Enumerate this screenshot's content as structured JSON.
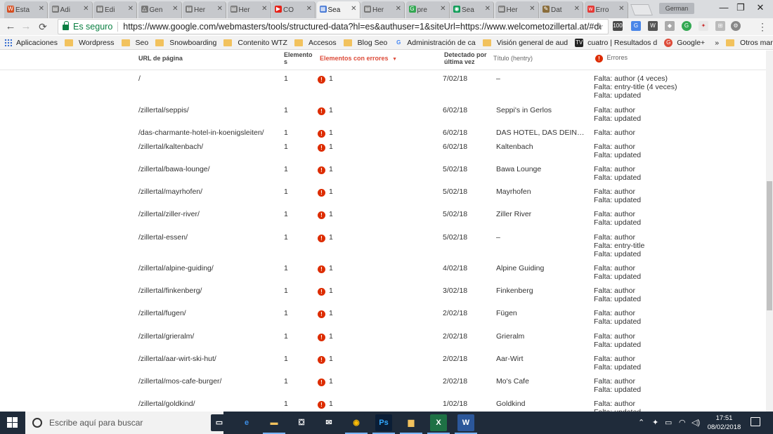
{
  "browser": {
    "tabs": [
      {
        "label": "Esta",
        "icon": "wordpress-icon",
        "color": "#d54e21",
        "active": false
      },
      {
        "label": "Adi",
        "icon": "document-icon",
        "color": "#777777",
        "active": false
      },
      {
        "label": "Edi",
        "icon": "document-icon",
        "color": "#777777",
        "active": false
      },
      {
        "label": "Gen",
        "icon": "drive-icon",
        "color": "#777777",
        "active": false
      },
      {
        "label": "Her",
        "icon": "document-icon",
        "color": "#777777",
        "active": false
      },
      {
        "label": "Her",
        "icon": "document-icon",
        "color": "#777777",
        "active": false
      },
      {
        "label": "CO",
        "icon": "youtube-icon",
        "color": "#e62117",
        "active": false
      },
      {
        "label": "Sea",
        "icon": "search-console-icon",
        "color": "#4a7bd6",
        "active": true
      },
      {
        "label": "Her",
        "icon": "document-icon",
        "color": "#777777",
        "active": false
      },
      {
        "label": "pre",
        "icon": "google-icon",
        "color": "#34a853",
        "active": false
      },
      {
        "label": "Sea",
        "icon": "chrome-icon",
        "color": "#0f9d58",
        "active": false
      },
      {
        "label": "Her",
        "icon": "document-icon",
        "color": "#777777",
        "active": false
      },
      {
        "label": "Dat",
        "icon": "pen-icon",
        "color": "#8a6d3b",
        "active": false
      },
      {
        "label": "Erro",
        "icon": "w-icon",
        "color": "#e53935",
        "active": false
      }
    ],
    "profile_name": "German",
    "address": {
      "secure_label": "Es seguro",
      "url": "https://www.google.com/webmasters/tools/structured-data?hl=es&authuser=1&siteUrl=https://www.welcometozillertal.at/#details/htt..."
    },
    "bookmarks": [
      {
        "label": "Aplicaciones",
        "type": "apps"
      },
      {
        "label": "Wordpress",
        "type": "folder"
      },
      {
        "label": "Seo",
        "type": "folder"
      },
      {
        "label": "Snowboarding",
        "type": "folder"
      },
      {
        "label": "Contenito WTZ",
        "type": "folder"
      },
      {
        "label": "Accesos",
        "type": "folder"
      },
      {
        "label": "Blog Seo",
        "type": "folder"
      },
      {
        "label": "Administración de ca",
        "type": "google"
      },
      {
        "label": "Visión general de aud",
        "type": "folder"
      },
      {
        "label": "cuatro | Resultados d",
        "type": "tv"
      },
      {
        "label": "Google+",
        "type": "gplus"
      }
    ],
    "bookmarks_more": "»",
    "other_bookmarks": "Otros marcadores"
  },
  "table": {
    "headers": {
      "url": "URL de página",
      "elements_line1": "Elemento",
      "elements_line2": "s",
      "errors_items": "Elementos con errores",
      "detected_line1": "Detectado por",
      "detected_line2": "última vez",
      "title": "Título (hentry)",
      "errors": "Errores"
    },
    "rows": [
      {
        "url": "/",
        "elements": "1",
        "error_count": "1",
        "date": "7/02/18",
        "title": "–",
        "errors": [
          "Falta: author (4 veces)",
          "Falta: entry-title (4 veces)",
          "Falta: updated"
        ]
      },
      {
        "url": "/zillertal/seppis/",
        "elements": "1",
        "error_count": "1",
        "date": "6/02/18",
        "title": "Seppi's in Gerlos",
        "errors": [
          "Falta: author",
          "Falta: updated"
        ]
      },
      {
        "url": "/das-charmante-hotel-in-koenigsleiten/",
        "elements": "1",
        "error_count": "1",
        "date": "6/02/18",
        "title": "DAS HOTEL, DAS DEINE ...",
        "errors": [
          "Falta: author"
        ]
      },
      {
        "url": "/zillertal/kaltenbach/",
        "elements": "1",
        "error_count": "1",
        "date": "6/02/18",
        "title": "Kaltenbach",
        "errors": [
          "Falta: author",
          "Falta: updated"
        ]
      },
      {
        "url": "/zillertal/bawa-lounge/",
        "elements": "1",
        "error_count": "1",
        "date": "5/02/18",
        "title": "Bawa Lounge",
        "errors": [
          "Falta: author",
          "Falta: updated"
        ]
      },
      {
        "url": "/zillertal/mayrhofen/",
        "elements": "1",
        "error_count": "1",
        "date": "5/02/18",
        "title": "Mayrhofen",
        "errors": [
          "Falta: author",
          "Falta: updated"
        ]
      },
      {
        "url": "/zillertal/ziller-river/",
        "elements": "1",
        "error_count": "1",
        "date": "5/02/18",
        "title": "Ziller River",
        "errors": [
          "Falta: author",
          "Falta: updated"
        ]
      },
      {
        "url": "/zillertal-essen/",
        "elements": "1",
        "error_count": "1",
        "date": "5/02/18",
        "title": "–",
        "errors": [
          "Falta: author",
          "Falta: entry-title",
          "Falta: updated"
        ]
      },
      {
        "url": "/zillertal/alpine-guiding/",
        "elements": "1",
        "error_count": "1",
        "date": "4/02/18",
        "title": "Alpine Guiding",
        "errors": [
          "Falta: author",
          "Falta: updated"
        ]
      },
      {
        "url": "/zillertal/finkenberg/",
        "elements": "1",
        "error_count": "1",
        "date": "3/02/18",
        "title": "Finkenberg",
        "errors": [
          "Falta: author",
          "Falta: updated"
        ]
      },
      {
        "url": "/zillertal/fugen/",
        "elements": "1",
        "error_count": "1",
        "date": "2/02/18",
        "title": "Fügen",
        "errors": [
          "Falta: author",
          "Falta: updated"
        ]
      },
      {
        "url": "/zillertal/grieralm/",
        "elements": "1",
        "error_count": "1",
        "date": "2/02/18",
        "title": "Grieralm",
        "errors": [
          "Falta: author",
          "Falta: updated"
        ]
      },
      {
        "url": "/zillertal/aar-wirt-ski-hut/",
        "elements": "1",
        "error_count": "1",
        "date": "2/02/18",
        "title": "Aar-Wirt",
        "errors": [
          "Falta: author",
          "Falta: updated"
        ]
      },
      {
        "url": "/zillertal/mos-cafe-burger/",
        "elements": "1",
        "error_count": "1",
        "date": "2/02/18",
        "title": "Mo's Cafe",
        "errors": [
          "Falta: author",
          "Falta: updated"
        ]
      },
      {
        "url": "/zillertal/goldkind/",
        "elements": "1",
        "error_count": "1",
        "date": "1/02/18",
        "title": "Goldkind",
        "errors": [
          "Falta: author",
          "Falta: updated"
        ]
      }
    ]
  },
  "taskbar": {
    "search_placeholder": "Escribe aquí para buscar",
    "time": "17:51",
    "date": "08/02/2018",
    "apps": [
      {
        "label": "",
        "icon": "task-view-icon"
      },
      {
        "label": "e",
        "icon": "edge-icon"
      },
      {
        "label": "",
        "icon": "file-explorer-icon"
      },
      {
        "label": "",
        "icon": "store-icon"
      },
      {
        "label": "",
        "icon": "mail-icon"
      },
      {
        "label": "",
        "icon": "chrome-icon"
      },
      {
        "label": "Ps",
        "icon": "photoshop-icon"
      },
      {
        "label": "",
        "icon": "folder-app-icon"
      },
      {
        "label": "X",
        "icon": "excel-icon"
      },
      {
        "label": "W",
        "icon": "word-icon"
      }
    ]
  },
  "colors": {
    "error_red": "#dd2c00",
    "header_red": "#dd4b39",
    "secure_green": "#0b8043",
    "taskbar_bg": "#1f2b3a"
  }
}
